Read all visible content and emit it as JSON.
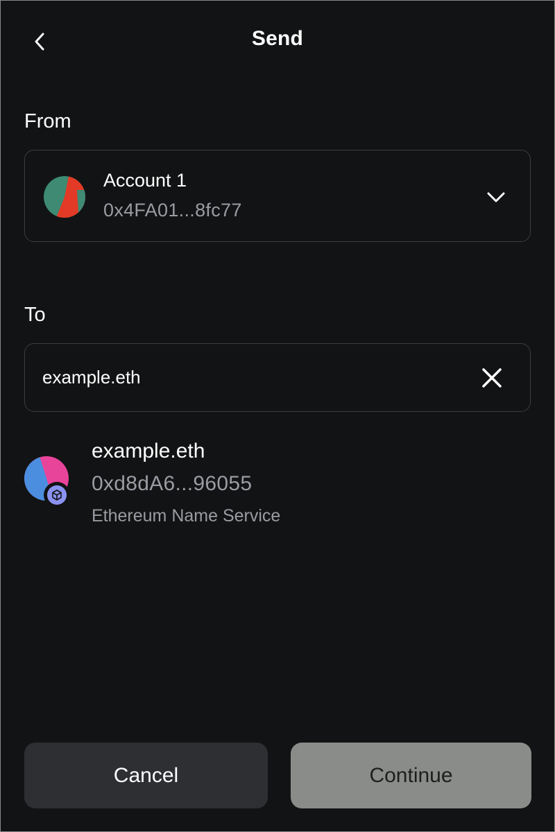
{
  "header": {
    "title": "Send",
    "back_icon": "chevron-left-icon"
  },
  "from": {
    "label": "From",
    "account_name": "Account 1",
    "account_address": "0x4FA01...8fc77",
    "dropdown_icon": "chevron-down-icon"
  },
  "to": {
    "label": "To",
    "input_value": "example.eth",
    "clear_icon": "close-icon"
  },
  "suggestion": {
    "name": "example.eth",
    "address": "0xd8dA6...96055",
    "service": "Ethereum Name Service",
    "badge_icon": "ens-cube-icon"
  },
  "actions": {
    "cancel_label": "Cancel",
    "continue_label": "Continue"
  },
  "colors": {
    "background": "#121314",
    "border": "#3b3d40",
    "muted_text": "#9a9ca3",
    "cancel_bg": "#2d2f33",
    "continue_bg": "#8a8c89",
    "ens_badge": "#8b93f0"
  }
}
